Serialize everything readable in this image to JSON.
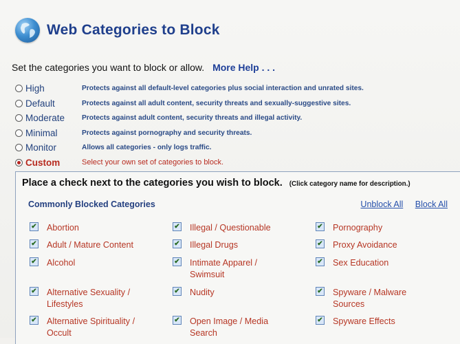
{
  "header": {
    "title": "Web Categories to Block",
    "icon": "globe-icon"
  },
  "intro": {
    "text": "Set the categories you want to block or allow.",
    "help_link": "More Help . . ."
  },
  "levels": [
    {
      "name": "High",
      "description": "Protects against all default-level categories plus social interaction and unrated sites."
    },
    {
      "name": "Default",
      "description": "Protects against all adult content, security threats and sexually-suggestive sites."
    },
    {
      "name": "Moderate",
      "description": "Protects against adult content, security threats and illegal activity."
    },
    {
      "name": "Minimal",
      "description": "Protects against pornography and security threats."
    },
    {
      "name": "Monitor",
      "description": "Allows all categories - only logs traffic."
    },
    {
      "name": "Custom",
      "description": "Select your own set of categories to block."
    }
  ],
  "selected_level": "Custom",
  "custom": {
    "instruction": "Place a check next to the categories you wish to block.",
    "instruction_note": "(Click category name for description.)",
    "section_title": "Commonly Blocked Categories",
    "unblock_all": "Unblock All",
    "block_all": "Block All",
    "categories": [
      {
        "label": "Abortion",
        "checked": true
      },
      {
        "label": "Illegal / Questionable",
        "checked": true
      },
      {
        "label": "Pornography",
        "checked": true
      },
      {
        "label": "Adult / Mature Content",
        "checked": true
      },
      {
        "label": "Illegal Drugs",
        "checked": true
      },
      {
        "label": "Proxy Avoidance",
        "checked": true
      },
      {
        "label": "Alcohol",
        "checked": true
      },
      {
        "label": "Intimate Apparel / Swimsuit",
        "checked": true
      },
      {
        "label": "Sex Education",
        "checked": true
      },
      {
        "label": "Alternative Sexuality / Lifestyles",
        "checked": true
      },
      {
        "label": "Nudity",
        "checked": true
      },
      {
        "label": "Spyware / Malware Sources",
        "checked": true
      },
      {
        "label": "Alternative Spirituality / Occult",
        "checked": true
      },
      {
        "label": "Open Image / Media Search",
        "checked": true
      },
      {
        "label": "Spyware Effects",
        "checked": true
      }
    ]
  },
  "colors": {
    "title": "#1f3f8c",
    "accent_red": "#b63624",
    "link": "#244faa"
  }
}
